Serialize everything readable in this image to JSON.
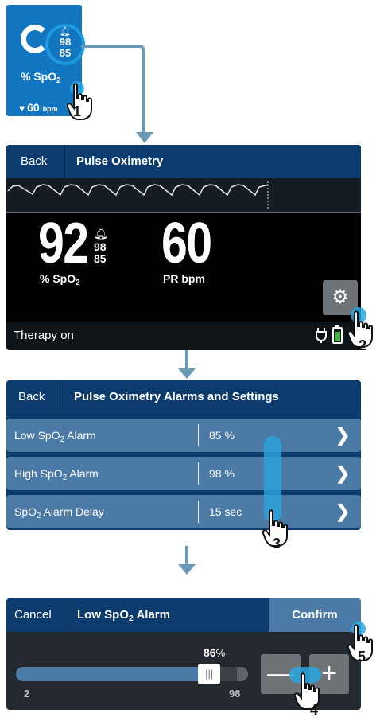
{
  "tile": {
    "bell_icon": "bell-icon",
    "alarm_high": "98",
    "alarm_low": "85",
    "unit": "% SpO",
    "unit_sub": "2",
    "pr_value": "60",
    "pr_unit": "bpm"
  },
  "screen1": {
    "back_label": "Back",
    "title": "Pulse Oximetry",
    "spo2_value": "92",
    "alarm_high": "98",
    "alarm_low": "85",
    "spo2_unit": "% SpO",
    "spo2_unit_sub": "2",
    "pr_value": "60",
    "pr_unit": "PR bpm",
    "status": "Therapy on",
    "battery_level": 0.7
  },
  "screen2": {
    "back_label": "Back",
    "title": "Pulse Oximetry Alarms and Settings",
    "rows": [
      {
        "label_pre": "Low SpO",
        "label_sub": "2",
        "label_post": " Alarm",
        "value": "85 %"
      },
      {
        "label_pre": "High SpO",
        "label_sub": "2",
        "label_post": " Alarm",
        "value": "98 %"
      },
      {
        "label_pre": "SpO",
        "label_sub": "2",
        "label_post": " Alarm Delay",
        "value": "15 sec"
      }
    ]
  },
  "screen3": {
    "cancel_label": "Cancel",
    "title_pre": "Low SpO",
    "title_sub": "2",
    "title_post": " Alarm",
    "confirm_label": "Confirm",
    "slider_value": "86",
    "slider_unit": "%",
    "slider_min": "2",
    "slider_max": "98",
    "minus_label": "—",
    "plus_label": "+"
  },
  "steps": [
    "1",
    "2",
    "3",
    "4",
    "5"
  ],
  "colors": {
    "tile_blue": "#1276c0",
    "header_navy": "#0c3c6e",
    "row_blue": "#4b7aa6",
    "touch_glow": "#29a7e1",
    "battery_green": "#43b04a"
  }
}
